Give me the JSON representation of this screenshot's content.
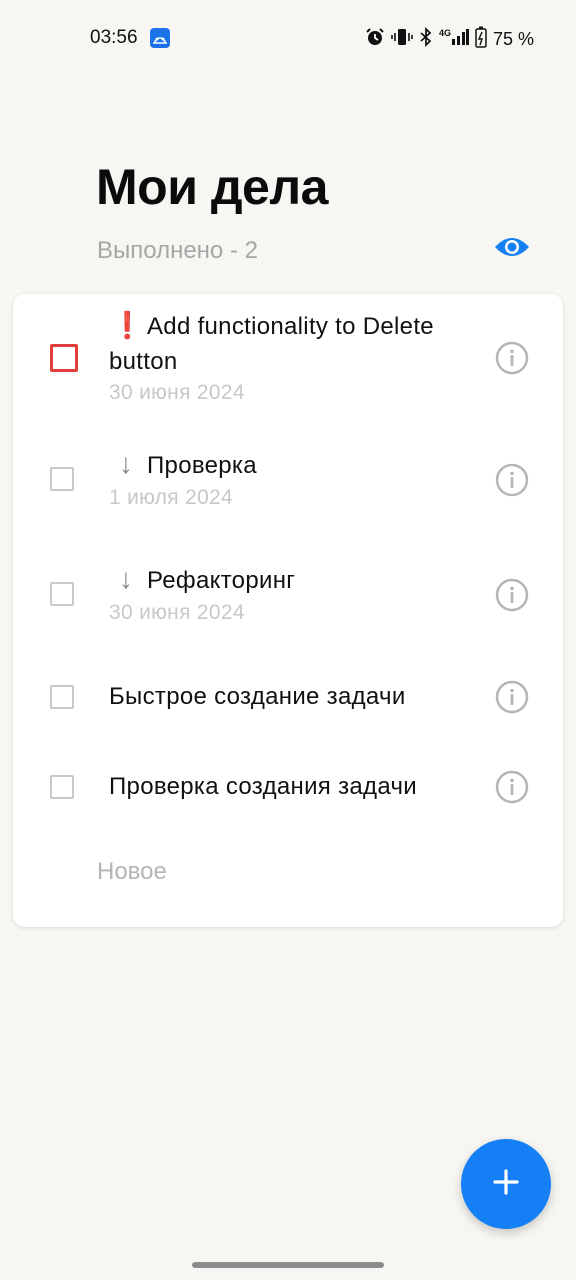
{
  "status_bar": {
    "time": "03:56",
    "battery": "75 %",
    "network": "4G",
    "icons": [
      "android-app-icon",
      "alarm-icon",
      "vibrate-icon",
      "bluetooth-icon",
      "signal-icon",
      "battery-icon"
    ]
  },
  "header": {
    "title": "Мои дела",
    "done_count": "Выполнено - 2",
    "visibility_icon": "eye-icon"
  },
  "tasks": [
    {
      "prefix": "❗",
      "priority": "high",
      "text": "Add functionality to Delete button",
      "date": "30 июня 2024",
      "checked": false
    },
    {
      "prefix": "↓",
      "priority": "low",
      "text": "Проверка",
      "date": "1 июля 2024",
      "checked": false
    },
    {
      "prefix": "↓",
      "priority": "low",
      "text": "Рефакторинг",
      "date": "30 июня 2024",
      "checked": false
    },
    {
      "prefix": "",
      "priority": "normal",
      "text": "Быстрое создание задачи",
      "date": "",
      "checked": false
    },
    {
      "prefix": "",
      "priority": "normal",
      "text": "Проверка создания задачи",
      "date": "",
      "checked": false
    }
  ],
  "new_task_placeholder": "Новое",
  "fab": {
    "icon": "plus-icon"
  },
  "colors": {
    "accent": "#1580f5",
    "urgent": "#e23d3d",
    "background": "#f7f6f2",
    "muted_text": "#a6a6a6"
  }
}
